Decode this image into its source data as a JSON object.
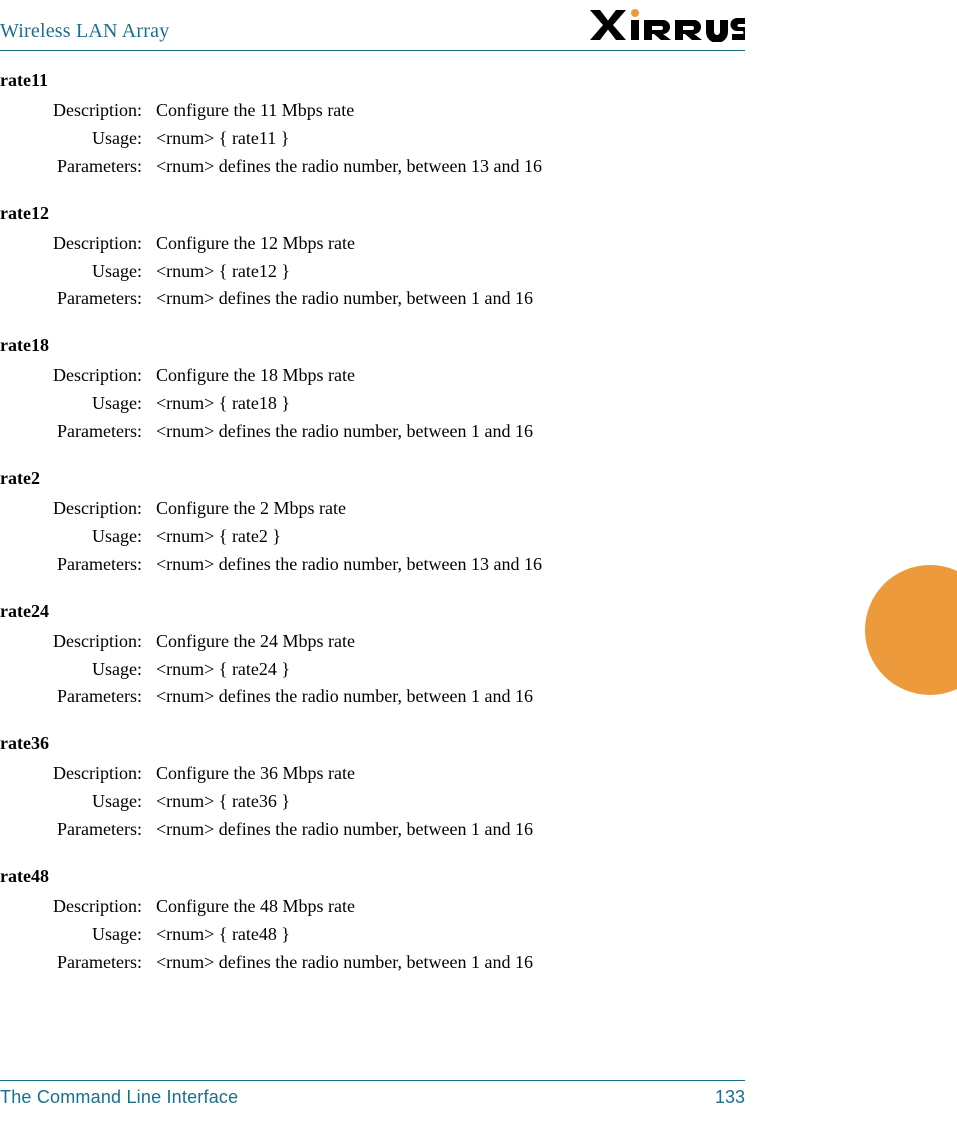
{
  "header": {
    "title": "Wireless LAN Array",
    "logo_text": "XIRRUS"
  },
  "labels": {
    "description": "Description:",
    "usage": "Usage:",
    "parameters": "Parameters:"
  },
  "commands": [
    {
      "name": "rate11",
      "description": "Configure the 11 Mbps rate",
      "usage": "<rnum> { rate11 }",
      "parameters": "<rnum> defines the radio number, between 13 and 16"
    },
    {
      "name": "rate12",
      "description": "Configure the 12 Mbps rate",
      "usage": "<rnum> { rate12 }",
      "parameters": "<rnum> defines the radio number, between 1 and 16"
    },
    {
      "name": "rate18",
      "description": "Configure the 18 Mbps rate",
      "usage": "<rnum> { rate18 }",
      "parameters": "<rnum> defines the radio number, between 1 and 16"
    },
    {
      "name": "rate2",
      "description": "Configure the 2 Mbps rate",
      "usage": "<rnum> { rate2 }",
      "parameters": "<rnum> defines the radio number, between 13 and 16"
    },
    {
      "name": "rate24",
      "description": "Configure the 24 Mbps rate",
      "usage": "<rnum> { rate24 }",
      "parameters": "<rnum> defines the radio number, between 1 and 16"
    },
    {
      "name": "rate36",
      "description": "Configure the 36 Mbps rate",
      "usage": "<rnum> { rate36 }",
      "parameters": "<rnum> defines the radio number, between 1 and 16"
    },
    {
      "name": "rate48",
      "description": "Configure the 48 Mbps rate",
      "usage": "<rnum> { rate48 }",
      "parameters": "<rnum> defines the radio number, between 1 and 16"
    }
  ],
  "footer": {
    "section": "The Command Line Interface",
    "page": "133"
  }
}
